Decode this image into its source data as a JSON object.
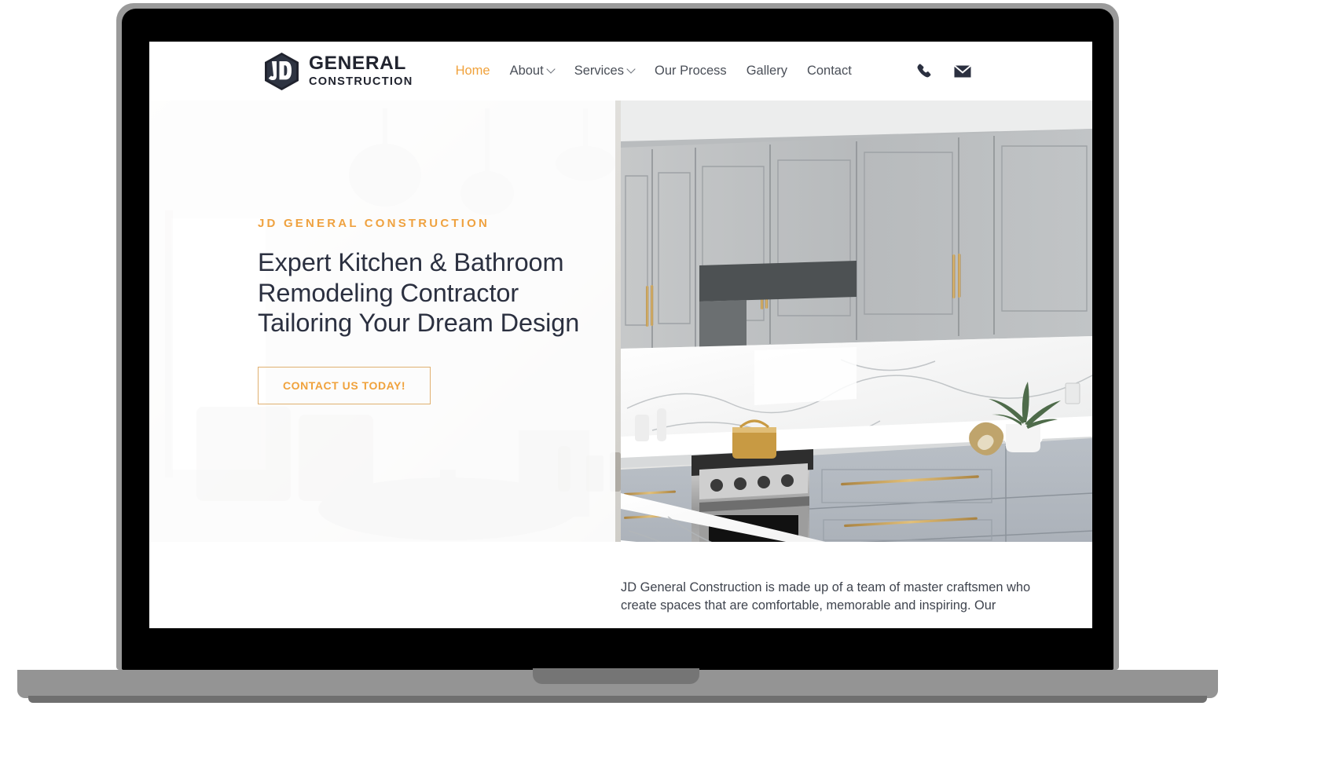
{
  "brand": {
    "logo_line1": "GENERAL",
    "logo_line2": "CONSTRUCTION",
    "logo_monogram": "JD",
    "accent_color": "#f0a23c",
    "dark_color": "#20232e"
  },
  "header": {
    "nav": [
      {
        "label": "Home",
        "active": true,
        "has_dropdown": false
      },
      {
        "label": "About",
        "active": false,
        "has_dropdown": true
      },
      {
        "label": "Services",
        "active": false,
        "has_dropdown": true
      },
      {
        "label": "Our Process",
        "active": false,
        "has_dropdown": false
      },
      {
        "label": "Gallery",
        "active": false,
        "has_dropdown": false
      },
      {
        "label": "Contact",
        "active": false,
        "has_dropdown": false
      }
    ],
    "actions": [
      {
        "icon": "phone-icon"
      },
      {
        "icon": "envelope-icon"
      }
    ]
  },
  "hero": {
    "eyebrow": "JD GENERAL CONSTRUCTION",
    "headline_lines": [
      "Expert Kitchen & Bathroom",
      "Remodeling Contractor",
      "Tailoring Your Dream Design"
    ],
    "headline": "Expert Kitchen & Bathroom Remodeling Contractor Tailoring Your Dream Design",
    "cta_label": "CONTACT US TODAY!",
    "image_alt": "Modern gray shaker kitchen with marble countertops, brass handles and stainless range"
  },
  "intro": {
    "paragraph": "JD General Construction is made up of a team of master craftsmen who create spaces that are comfortable, memorable and inspiring. Our"
  }
}
